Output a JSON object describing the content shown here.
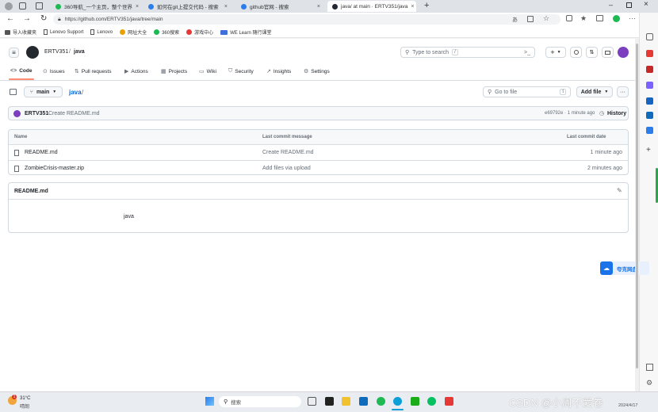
{
  "browser": {
    "tabs": [
      {
        "title": "360导航_一个主页，整个世界",
        "favicon_color": "#1fb954"
      },
      {
        "title": "如何在git上提交代码 - 搜索",
        "favicon_color": "#2b7de9"
      },
      {
        "title": "github官网 - 搜索",
        "favicon_color": "#2b7de9"
      },
      {
        "title": "java/ at main · ERTV351/java",
        "favicon_color": "#24292f"
      }
    ],
    "new_tab_label": "+",
    "url": "https://github.com/ERTV351/java/tree/main",
    "bookmarks": [
      {
        "label": "导入收藏夹",
        "color": "#555555"
      },
      {
        "label": "Lenovo Support",
        "color": "#555555"
      },
      {
        "label": "Lenovo",
        "color": "#555555"
      },
      {
        "label": "网址大全",
        "color": "#e7a200"
      },
      {
        "label": "360搜索",
        "color": "#1fb954"
      },
      {
        "label": "游戏中心",
        "color": "#e53935"
      },
      {
        "label": "WE Learn 随行课堂",
        "color": "#3f6fd8"
      }
    ]
  },
  "github": {
    "owner": "ERTV351",
    "separator": "/",
    "repo": "java",
    "search_placeholder": "Type to search",
    "search_shortcut": "/",
    "add_label": "+",
    "nav": [
      {
        "label": "Code",
        "icon": "code-icon"
      },
      {
        "label": "Issues",
        "icon": "issue-icon"
      },
      {
        "label": "Pull requests",
        "icon": "pull-request-icon"
      },
      {
        "label": "Actions",
        "icon": "play-icon"
      },
      {
        "label": "Projects",
        "icon": "table-icon"
      },
      {
        "label": "Wiki",
        "icon": "book-icon"
      },
      {
        "label": "Security",
        "icon": "shield-icon"
      },
      {
        "label": "Insights",
        "icon": "graph-icon"
      },
      {
        "label": "Settings",
        "icon": "gear-icon"
      }
    ],
    "branch": "main",
    "path": "java",
    "path_sep": "/",
    "goto_placeholder": "Go to file",
    "goto_shortcut": "t",
    "add_file_label": "Add file",
    "more_label": "···",
    "commit": {
      "author": "ERTV351",
      "message": "Create README.md",
      "meta": "e69792e · 1 minute ago",
      "history_label": "History"
    },
    "table": {
      "headers": [
        "Name",
        "Last commit message",
        "Last commit date"
      ],
      "rows": [
        {
          "name": "README.md",
          "message": "Create README.md",
          "date": "1 minute ago"
        },
        {
          "name": "ZombieCrisis-master.zip",
          "message": "Add files via upload",
          "date": "2 minutes ago"
        }
      ]
    },
    "readme": {
      "title": "README.md",
      "content": "java"
    }
  },
  "floating_widget": {
    "label": "夸克网盘",
    "color": "#1a73e8"
  },
  "taskbar": {
    "weather_temp": "31°C",
    "weather_desc": "晴朗",
    "weather_badge": "1",
    "search_placeholder": "搜索",
    "watermark": "CSDN @小周不爱卷",
    "date": "2024/4/17"
  }
}
